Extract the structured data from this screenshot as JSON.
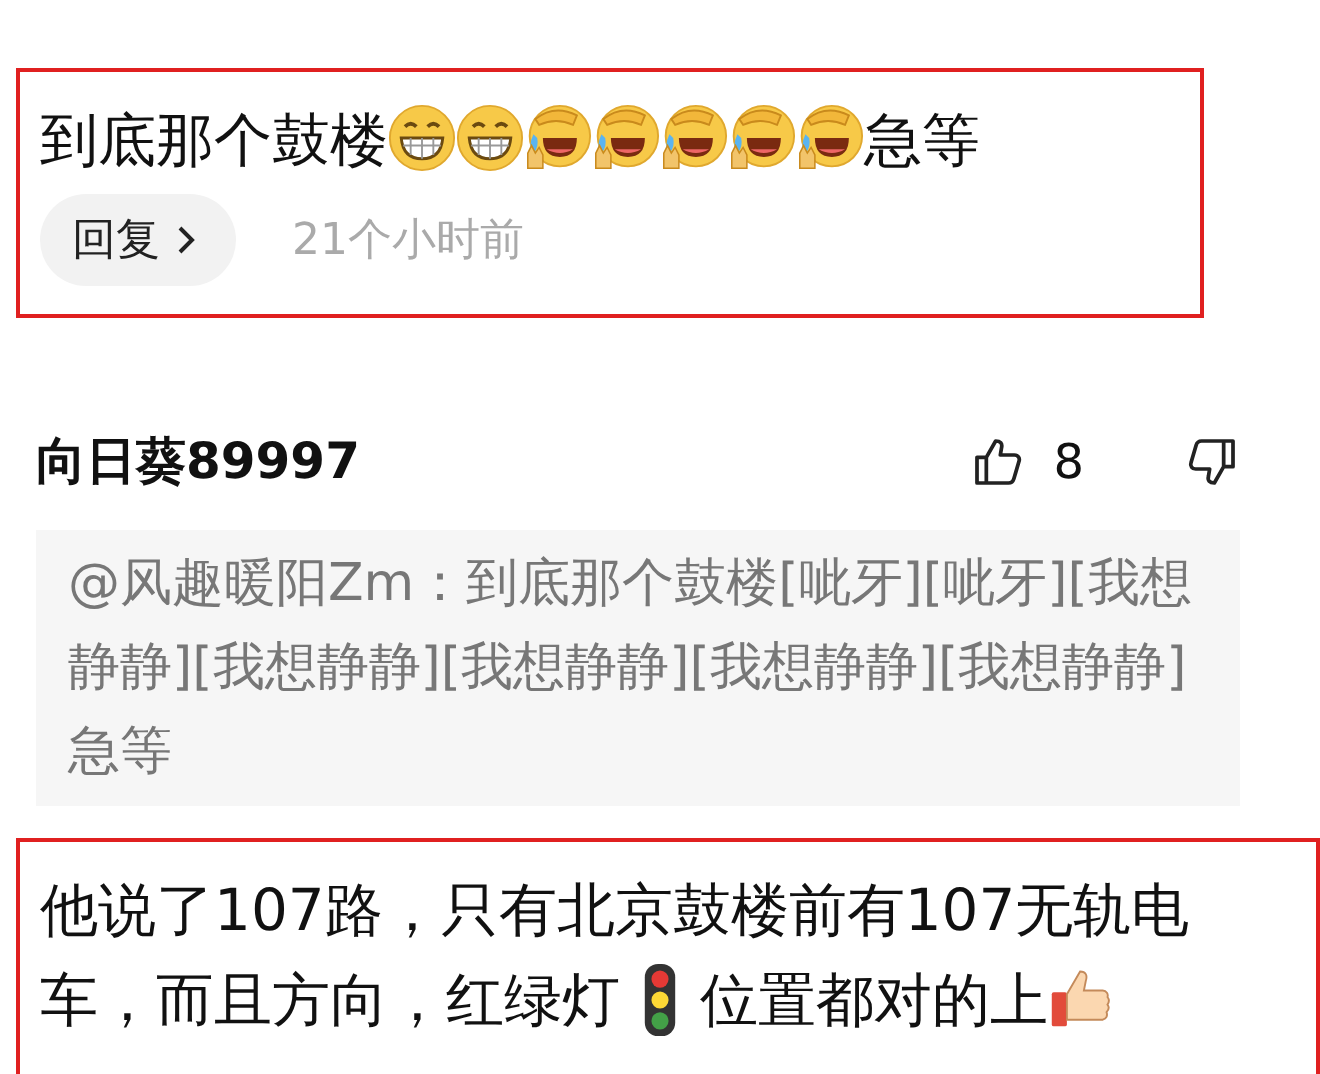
{
  "comments": [
    {
      "kind": "reply-target",
      "content": [
        {
          "kind": "text",
          "text": "到底那个鼓楼"
        },
        {
          "kind": "grin"
        },
        {
          "kind": "grin"
        },
        {
          "kind": "laugh"
        },
        {
          "kind": "laugh"
        },
        {
          "kind": "laugh"
        },
        {
          "kind": "laugh"
        },
        {
          "kind": "laugh"
        },
        {
          "kind": "text",
          "text": "急等"
        }
      ],
      "reply_button": "回复",
      "time": "21个小时前",
      "highlighted": true
    },
    {
      "kind": "comment",
      "author": "向日葵89997",
      "likes": "8",
      "quote": "@风趣暖阳Zm：到底那个鼓楼[呲牙][呲牙][我想静静][我想静静][我想静静][我想静静][我想静静]急等",
      "content": [
        {
          "kind": "text",
          "text": "他说了107路，只有北京鼓楼前有107无轨电车，而且方向，红绿灯"
        },
        {
          "kind": "traffic-light"
        },
        {
          "kind": "text",
          "text": "位置都对的上"
        },
        {
          "kind": "thumbs-up"
        }
      ],
      "highlighted": true
    }
  ]
}
